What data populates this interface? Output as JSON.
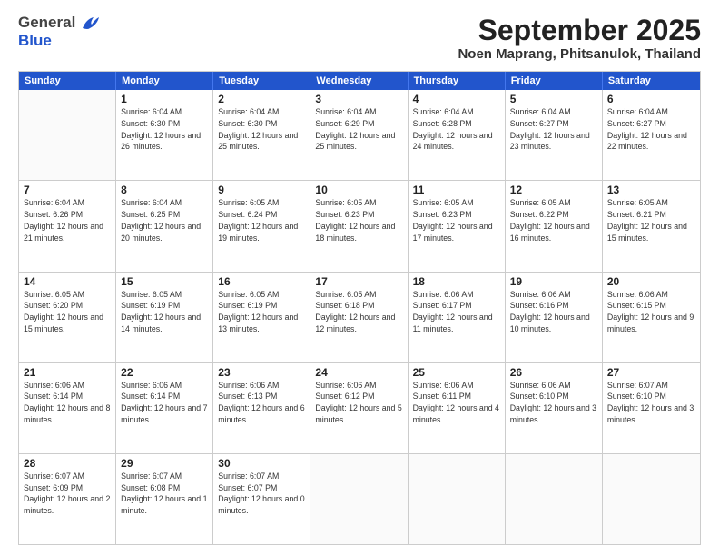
{
  "header": {
    "logo_general": "General",
    "logo_blue": "Blue",
    "month_title": "September 2025",
    "location": "Noen Maprang, Phitsanulok, Thailand"
  },
  "days": [
    "Sunday",
    "Monday",
    "Tuesday",
    "Wednesday",
    "Thursday",
    "Friday",
    "Saturday"
  ],
  "rows": [
    [
      {
        "day": "",
        "empty": true
      },
      {
        "day": "1",
        "sunrise": "Sunrise: 6:04 AM",
        "sunset": "Sunset: 6:30 PM",
        "daylight": "Daylight: 12 hours and 26 minutes."
      },
      {
        "day": "2",
        "sunrise": "Sunrise: 6:04 AM",
        "sunset": "Sunset: 6:30 PM",
        "daylight": "Daylight: 12 hours and 25 minutes."
      },
      {
        "day": "3",
        "sunrise": "Sunrise: 6:04 AM",
        "sunset": "Sunset: 6:29 PM",
        "daylight": "Daylight: 12 hours and 25 minutes."
      },
      {
        "day": "4",
        "sunrise": "Sunrise: 6:04 AM",
        "sunset": "Sunset: 6:28 PM",
        "daylight": "Daylight: 12 hours and 24 minutes."
      },
      {
        "day": "5",
        "sunrise": "Sunrise: 6:04 AM",
        "sunset": "Sunset: 6:27 PM",
        "daylight": "Daylight: 12 hours and 23 minutes."
      },
      {
        "day": "6",
        "sunrise": "Sunrise: 6:04 AM",
        "sunset": "Sunset: 6:27 PM",
        "daylight": "Daylight: 12 hours and 22 minutes."
      }
    ],
    [
      {
        "day": "7",
        "sunrise": "Sunrise: 6:04 AM",
        "sunset": "Sunset: 6:26 PM",
        "daylight": "Daylight: 12 hours and 21 minutes."
      },
      {
        "day": "8",
        "sunrise": "Sunrise: 6:04 AM",
        "sunset": "Sunset: 6:25 PM",
        "daylight": "Daylight: 12 hours and 20 minutes."
      },
      {
        "day": "9",
        "sunrise": "Sunrise: 6:05 AM",
        "sunset": "Sunset: 6:24 PM",
        "daylight": "Daylight: 12 hours and 19 minutes."
      },
      {
        "day": "10",
        "sunrise": "Sunrise: 6:05 AM",
        "sunset": "Sunset: 6:23 PM",
        "daylight": "Daylight: 12 hours and 18 minutes."
      },
      {
        "day": "11",
        "sunrise": "Sunrise: 6:05 AM",
        "sunset": "Sunset: 6:23 PM",
        "daylight": "Daylight: 12 hours and 17 minutes."
      },
      {
        "day": "12",
        "sunrise": "Sunrise: 6:05 AM",
        "sunset": "Sunset: 6:22 PM",
        "daylight": "Daylight: 12 hours and 16 minutes."
      },
      {
        "day": "13",
        "sunrise": "Sunrise: 6:05 AM",
        "sunset": "Sunset: 6:21 PM",
        "daylight": "Daylight: 12 hours and 15 minutes."
      }
    ],
    [
      {
        "day": "14",
        "sunrise": "Sunrise: 6:05 AM",
        "sunset": "Sunset: 6:20 PM",
        "daylight": "Daylight: 12 hours and 15 minutes."
      },
      {
        "day": "15",
        "sunrise": "Sunrise: 6:05 AM",
        "sunset": "Sunset: 6:19 PM",
        "daylight": "Daylight: 12 hours and 14 minutes."
      },
      {
        "day": "16",
        "sunrise": "Sunrise: 6:05 AM",
        "sunset": "Sunset: 6:19 PM",
        "daylight": "Daylight: 12 hours and 13 minutes."
      },
      {
        "day": "17",
        "sunrise": "Sunrise: 6:05 AM",
        "sunset": "Sunset: 6:18 PM",
        "daylight": "Daylight: 12 hours and 12 minutes."
      },
      {
        "day": "18",
        "sunrise": "Sunrise: 6:06 AM",
        "sunset": "Sunset: 6:17 PM",
        "daylight": "Daylight: 12 hours and 11 minutes."
      },
      {
        "day": "19",
        "sunrise": "Sunrise: 6:06 AM",
        "sunset": "Sunset: 6:16 PM",
        "daylight": "Daylight: 12 hours and 10 minutes."
      },
      {
        "day": "20",
        "sunrise": "Sunrise: 6:06 AM",
        "sunset": "Sunset: 6:15 PM",
        "daylight": "Daylight: 12 hours and 9 minutes."
      }
    ],
    [
      {
        "day": "21",
        "sunrise": "Sunrise: 6:06 AM",
        "sunset": "Sunset: 6:14 PM",
        "daylight": "Daylight: 12 hours and 8 minutes."
      },
      {
        "day": "22",
        "sunrise": "Sunrise: 6:06 AM",
        "sunset": "Sunset: 6:14 PM",
        "daylight": "Daylight: 12 hours and 7 minutes."
      },
      {
        "day": "23",
        "sunrise": "Sunrise: 6:06 AM",
        "sunset": "Sunset: 6:13 PM",
        "daylight": "Daylight: 12 hours and 6 minutes."
      },
      {
        "day": "24",
        "sunrise": "Sunrise: 6:06 AM",
        "sunset": "Sunset: 6:12 PM",
        "daylight": "Daylight: 12 hours and 5 minutes."
      },
      {
        "day": "25",
        "sunrise": "Sunrise: 6:06 AM",
        "sunset": "Sunset: 6:11 PM",
        "daylight": "Daylight: 12 hours and 4 minutes."
      },
      {
        "day": "26",
        "sunrise": "Sunrise: 6:06 AM",
        "sunset": "Sunset: 6:10 PM",
        "daylight": "Daylight: 12 hours and 3 minutes."
      },
      {
        "day": "27",
        "sunrise": "Sunrise: 6:07 AM",
        "sunset": "Sunset: 6:10 PM",
        "daylight": "Daylight: 12 hours and 3 minutes."
      }
    ],
    [
      {
        "day": "28",
        "sunrise": "Sunrise: 6:07 AM",
        "sunset": "Sunset: 6:09 PM",
        "daylight": "Daylight: 12 hours and 2 minutes."
      },
      {
        "day": "29",
        "sunrise": "Sunrise: 6:07 AM",
        "sunset": "Sunset: 6:08 PM",
        "daylight": "Daylight: 12 hours and 1 minute."
      },
      {
        "day": "30",
        "sunrise": "Sunrise: 6:07 AM",
        "sunset": "Sunset: 6:07 PM",
        "daylight": "Daylight: 12 hours and 0 minutes."
      },
      {
        "day": "",
        "empty": true
      },
      {
        "day": "",
        "empty": true
      },
      {
        "day": "",
        "empty": true
      },
      {
        "day": "",
        "empty": true
      }
    ]
  ]
}
